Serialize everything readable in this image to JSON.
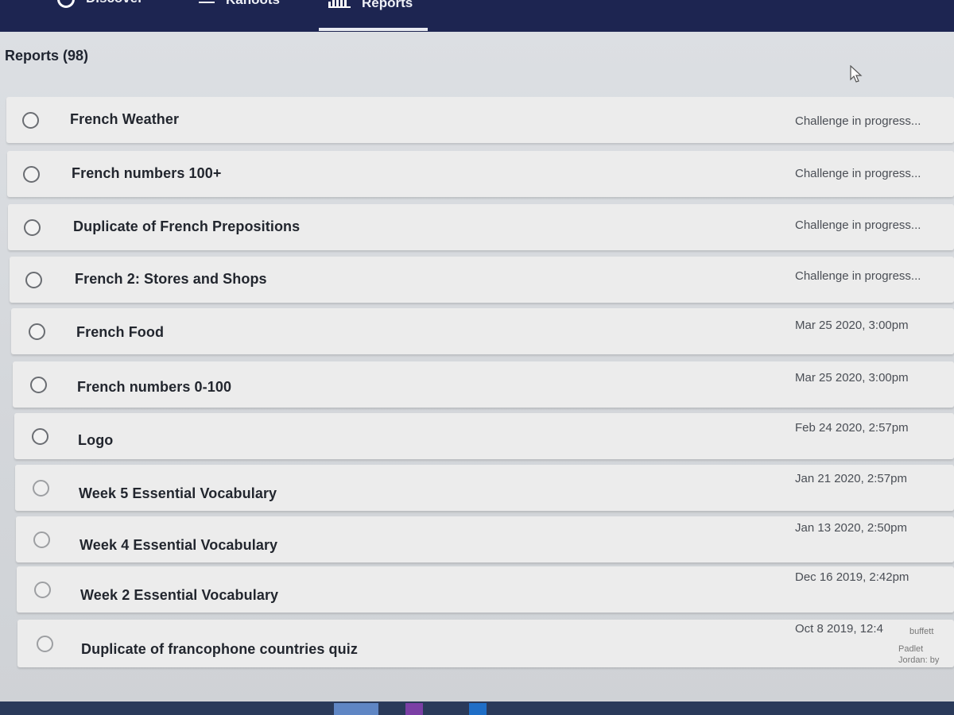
{
  "nav": {
    "discover_label": "Discover",
    "kahoots_label": "Kahoots",
    "reports_label": "Reports"
  },
  "page": {
    "title": "Reports (98)"
  },
  "reports": [
    {
      "title": "French Weather",
      "status": "Challenge in progress..."
    },
    {
      "title": "French numbers 100+",
      "status": "Challenge in progress..."
    },
    {
      "title": "Duplicate of French Prepositions",
      "status": "Challenge in progress..."
    },
    {
      "title": "French 2: Stores and Shops",
      "status": "Challenge in progress..."
    },
    {
      "title": "French Food",
      "status": "Mar 25 2020, 3:00pm"
    },
    {
      "title": "French numbers 0-100",
      "status": "Mar 25 2020, 3:00pm"
    },
    {
      "title": "Logo",
      "status": "Feb 24 2020, 2:57pm"
    },
    {
      "title": "Week 5 Essential Vocabulary",
      "status": "Jan 21 2020, 2:57pm"
    },
    {
      "title": "Week 4 Essential Vocabulary",
      "status": "Jan 13 2020, 2:50pm"
    },
    {
      "title": "Week 2 Essential Vocabulary",
      "status": "Dec 16 2019, 2:42pm"
    },
    {
      "title": "Duplicate of francophone countries quiz",
      "status": "Oct 8 2019, 12:4"
    }
  ],
  "notification": {
    "line1": "buffett",
    "line2": "Padlet",
    "line3": "Jordan: by"
  },
  "colors": {
    "topbar": "#1d2551",
    "row_bg": "#ececec",
    "page_bg": "#d6d9dc"
  },
  "icons": [
    "discover-icon",
    "kahoots-icon",
    "reports-icon",
    "mouse-cursor-icon"
  ]
}
